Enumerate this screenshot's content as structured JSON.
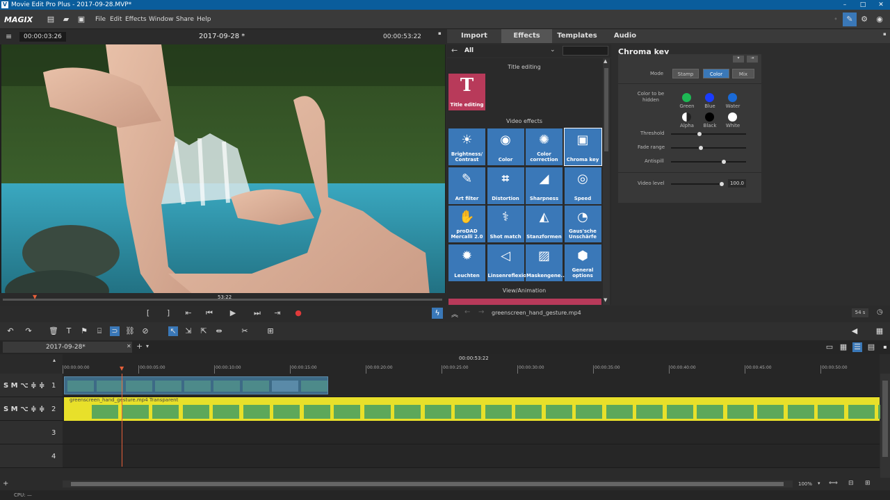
{
  "window": {
    "title": "Movie Edit Pro Plus - 2017-09-28.MVP*",
    "app_logo": "MAGIX"
  },
  "menu": [
    "File",
    "Edit",
    "Effects",
    "Window",
    "Share",
    "Help"
  ],
  "preview": {
    "timecode_left": "00:00:03:26",
    "project_name": "2017-09-28 *",
    "timecode_right": "00:00:53:22",
    "scrub_label": "53:22"
  },
  "tabs": [
    "Import",
    "Effects",
    "Templates",
    "Audio"
  ],
  "effects": {
    "category": "All",
    "sections": {
      "title": "Title editing",
      "video": "Video effects",
      "view": "View/Animation"
    },
    "title_tile": "Title editing",
    "tiles": [
      {
        "label": "Brightness/ Contrast",
        "icon": "sun-icon"
      },
      {
        "label": "Color",
        "icon": "palette-icon"
      },
      {
        "label": "Color correction",
        "icon": "color-wheel-icon"
      },
      {
        "label": "Chroma key",
        "icon": "chroma-icon"
      },
      {
        "label": "Art filter",
        "icon": "art-icon"
      },
      {
        "label": "Distortion",
        "icon": "grid-icon"
      },
      {
        "label": "Sharpness",
        "icon": "sharpness-icon"
      },
      {
        "label": "Speed",
        "icon": "speed-icon"
      },
      {
        "label": "proDAD Mercalli 2.0",
        "icon": "hand-icon"
      },
      {
        "label": "Shot match",
        "icon": "shot-match-icon"
      },
      {
        "label": "Stanzformen",
        "icon": "shape-icon"
      },
      {
        "label": "Gaus'sche Unschärfe",
        "icon": "blur-icon"
      },
      {
        "label": "Leuchten",
        "icon": "glow-icon"
      },
      {
        "label": "Linsenreflexion",
        "icon": "lens-icon"
      },
      {
        "label": "Maskengene...",
        "icon": "mask-icon"
      },
      {
        "label": "General options",
        "icon": "hexagon-icon"
      }
    ]
  },
  "chroma": {
    "title": "Chroma key",
    "mode_label": "Mode",
    "modes": [
      "Stamp",
      "Color",
      "Mix"
    ],
    "selected_mode": "Color",
    "color_label": "Color to be hidden",
    "colors": [
      {
        "name": "Green",
        "hex": "#1db954"
      },
      {
        "name": "Blue",
        "hex": "#1a3cff"
      },
      {
        "name": "Water",
        "hex": "#1a6ad6"
      },
      {
        "name": "Alpha",
        "hex": "#888888"
      },
      {
        "name": "Black",
        "hex": "#000000"
      },
      {
        "name": "White",
        "hex": "#ffffff"
      }
    ],
    "threshold_label": "Threshold",
    "threshold": 0.38,
    "fade_label": "Fade range",
    "fade": 0.4,
    "antispill_label": "Antispill",
    "antispill": 0.7,
    "video_level_label": "Video level",
    "video_level": "100.0"
  },
  "bottom_bar": {
    "filename": "greenscreen_hand_gesture.mp4",
    "duration": "54 s"
  },
  "timeline": {
    "project_tab": "2017-09-28*",
    "position_marker": "00:00:53:22",
    "ruler": [
      "00:00:00:00",
      "00:00:05:00",
      "00:00:10:00",
      "00:00:15:00",
      "00:00:20:00",
      "00:00:25:00",
      "00:00:30:00",
      "00:00:35:00",
      "00:00:40:00",
      "00:00:45:00",
      "00:00:50:00"
    ],
    "tracks": [
      "1",
      "2",
      "3",
      "4"
    ],
    "track2_label": "greenscreen_hand_gesture.mp4 Transparent",
    "zoom": "100%"
  },
  "status": {
    "cpu": "CPU: —"
  }
}
